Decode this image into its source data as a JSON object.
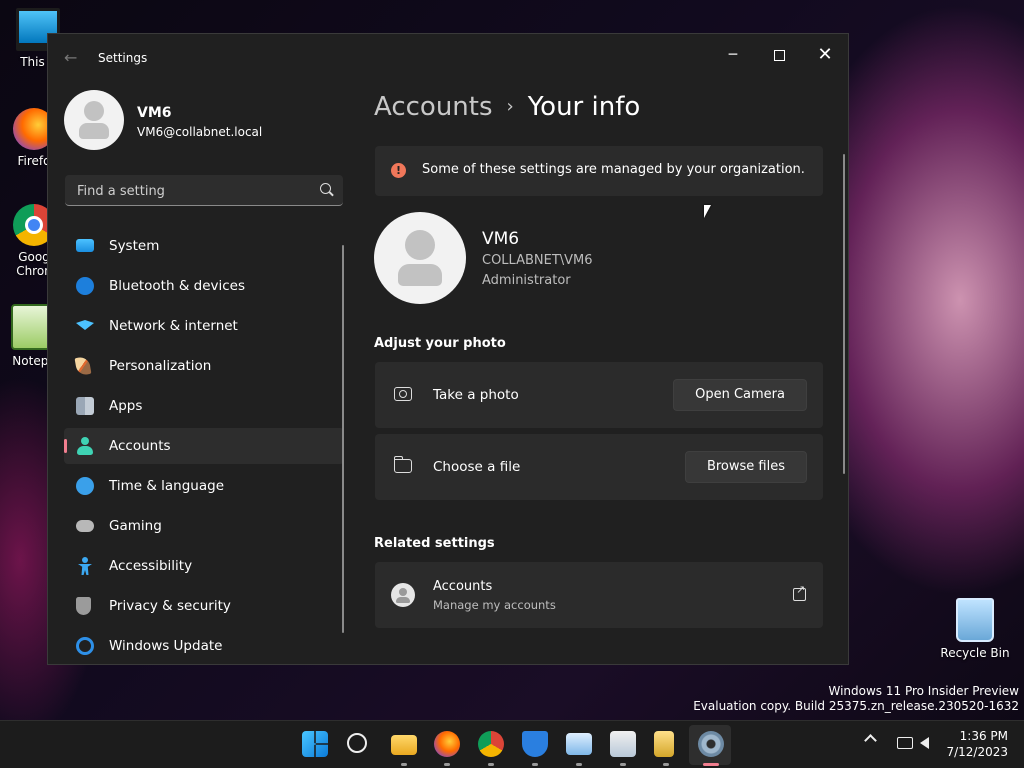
{
  "desktop": {
    "icons": [
      {
        "label": "This P"
      },
      {
        "label": "Firefo"
      },
      {
        "label": "Goog Chron"
      },
      {
        "label": "Notepa"
      },
      {
        "label": "Recycle Bin"
      }
    ],
    "watermark": {
      "line1": "Windows 11 Pro Insider Preview",
      "line2": "Evaluation copy. Build 25375.zn_release.230520-1632"
    }
  },
  "window": {
    "title": "Settings",
    "controls": {
      "minimize": "─",
      "close": "✕"
    },
    "back_icon": "←"
  },
  "profile": {
    "name": "VM6",
    "email": "VM6@collabnet.local"
  },
  "search": {
    "placeholder": "Find a setting"
  },
  "nav": {
    "items": [
      {
        "label": "System",
        "icon": "monitor-icon"
      },
      {
        "label": "Bluetooth & devices",
        "icon": "bluetooth-icon"
      },
      {
        "label": "Network & internet",
        "icon": "wifi-icon"
      },
      {
        "label": "Personalization",
        "icon": "brush-icon"
      },
      {
        "label": "Apps",
        "icon": "apps-icon"
      },
      {
        "label": "Accounts",
        "icon": "person-icon",
        "active": true
      },
      {
        "label": "Time & language",
        "icon": "clock-globe-icon"
      },
      {
        "label": "Gaming",
        "icon": "gamepad-icon"
      },
      {
        "label": "Accessibility",
        "icon": "accessibility-icon"
      },
      {
        "label": "Privacy & security",
        "icon": "shield-icon"
      },
      {
        "label": "Windows Update",
        "icon": "update-icon"
      }
    ],
    "accent": "#f17e8f"
  },
  "main": {
    "breadcrumb": {
      "parent": "Accounts",
      "separator": "›",
      "current": "Your info"
    },
    "banner": {
      "icon": "!",
      "text": "Some of these settings are managed by your organization."
    },
    "user": {
      "name": "VM6",
      "domain": "COLLABNET\\VM6",
      "role": "Administrator"
    },
    "adjust_photo": {
      "heading": "Adjust your photo",
      "take_photo": {
        "label": "Take a photo",
        "button": "Open Camera"
      },
      "choose_file": {
        "label": "Choose a file",
        "button": "Browse files"
      }
    },
    "related": {
      "heading": "Related settings",
      "accounts": {
        "title": "Accounts",
        "subtitle": "Manage my accounts"
      }
    }
  },
  "taskbar": {
    "apps": [
      "start-icon",
      "search-icon",
      "file-explorer-icon",
      "firefox-icon",
      "chrome-icon",
      "defender-icon",
      "performance-monitor-icon",
      "notepad-icon",
      "documents-icon",
      "settings-icon"
    ],
    "time": "1:36 PM",
    "date": "7/12/2023"
  }
}
